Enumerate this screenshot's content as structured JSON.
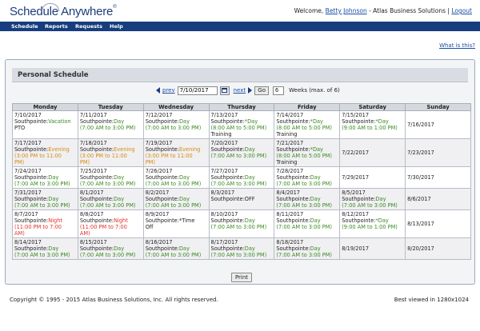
{
  "header": {
    "logo_text": "Schedule Anywhere",
    "logo_mark": "®",
    "welcome_prefix": "Welcome, ",
    "user_name": "Betty Johnson",
    "company": " - Atlas Business Solutions | ",
    "logout": "Logout"
  },
  "nav": {
    "items": [
      "Schedule",
      "Reports",
      "Requests",
      "Help"
    ]
  },
  "help_link": "What is this?",
  "panel": {
    "title": "Personal Schedule",
    "prev_label": "prev",
    "date_value": "7/10/2017",
    "next_label": "next",
    "go_label": "Go",
    "weeks_value": "6",
    "weeks_label": "Weeks (max. of 6)"
  },
  "table": {
    "headers": [
      "Monday",
      "Tuesday",
      "Wednesday",
      "Thursday",
      "Friday",
      "Saturday",
      "Sunday"
    ],
    "rows": [
      [
        {
          "date": "7/10/2017",
          "lines": [
            {
              "text": "Southpointe:",
              "c": "dark"
            },
            {
              "text": "Vacation",
              "c": "day"
            },
            {
              "text": "PTO",
              "c": "dark",
              "br": true
            }
          ]
        },
        {
          "date": "7/11/2017",
          "lines": [
            {
              "text": "Southpointe:",
              "c": "dark"
            },
            {
              "text": "Day",
              "c": "day"
            },
            {
              "text": "(7:00 AM to 3:00 PM)",
              "c": "day",
              "br": true
            }
          ]
        },
        {
          "date": "7/12/2017",
          "lines": [
            {
              "text": "Southpointe:",
              "c": "dark"
            },
            {
              "text": "Day",
              "c": "day"
            },
            {
              "text": "(7:00 AM to 3:00 PM)",
              "c": "day",
              "br": true
            }
          ]
        },
        {
          "date": "7/13/2017",
          "lines": [
            {
              "text": "Southpointe:",
              "c": "dark"
            },
            {
              "text": "*Day",
              "c": "day"
            },
            {
              "text": "(8:00 AM to 5:00 PM)",
              "c": "day",
              "br": true
            },
            {
              "text": "Training",
              "c": "dark",
              "br": true
            }
          ]
        },
        {
          "date": "7/14/2017",
          "lines": [
            {
              "text": "Southpointe:",
              "c": "dark"
            },
            {
              "text": "*Day",
              "c": "day"
            },
            {
              "text": "(8:00 AM to 5:00 PM)",
              "c": "day",
              "br": true
            },
            {
              "text": "Training",
              "c": "dark",
              "br": true
            }
          ]
        },
        {
          "date": "7/15/2017",
          "lines": [
            {
              "text": "Southpointe:",
              "c": "dark"
            },
            {
              "text": "*Day",
              "c": "day"
            },
            {
              "text": "(9:00 AM to 1:00 PM)",
              "c": "day",
              "br": true
            }
          ]
        },
        {
          "date": "7/16/2017",
          "single": true,
          "lines": []
        }
      ],
      [
        {
          "date": "7/17/2017",
          "lines": [
            {
              "text": "Southpointe:",
              "c": "dark"
            },
            {
              "text": "Evening",
              "c": "eve"
            },
            {
              "text": "(3:00 PM to 11:00",
              "c": "eve",
              "br": true
            },
            {
              "text": "PM)",
              "c": "eve",
              "br": true
            }
          ]
        },
        {
          "date": "7/18/2017",
          "lines": [
            {
              "text": "Southpointe:",
              "c": "dark"
            },
            {
              "text": "Evening",
              "c": "eve"
            },
            {
              "text": "(3:00 PM to 11:00",
              "c": "eve",
              "br": true
            },
            {
              "text": "PM)",
              "c": "eve",
              "br": true
            }
          ]
        },
        {
          "date": "7/19/2017",
          "lines": [
            {
              "text": "Southpointe:",
              "c": "dark"
            },
            {
              "text": "Evening",
              "c": "eve"
            },
            {
              "text": "(3:00 PM to 11:00",
              "c": "eve",
              "br": true
            },
            {
              "text": "PM)",
              "c": "eve",
              "br": true
            }
          ]
        },
        {
          "date": "7/20/2017",
          "lines": [
            {
              "text": "Southpointe:",
              "c": "dark"
            },
            {
              "text": "Day",
              "c": "day"
            },
            {
              "text": "(7:00 AM to 3:00 PM)",
              "c": "day",
              "br": true
            }
          ]
        },
        {
          "date": "7/21/2017",
          "lines": [
            {
              "text": "Southpointe:",
              "c": "dark"
            },
            {
              "text": "*Day",
              "c": "day"
            },
            {
              "text": "(8:00 AM to 5:00 PM)",
              "c": "day",
              "br": true
            },
            {
              "text": "Training",
              "c": "dark",
              "br": true
            }
          ]
        },
        {
          "date": "7/22/2017",
          "single": true,
          "lines": []
        },
        {
          "date": "7/23/2017",
          "single": true,
          "lines": []
        }
      ],
      [
        {
          "date": "7/24/2017",
          "lines": [
            {
              "text": "Southpointe:",
              "c": "dark"
            },
            {
              "text": "Day",
              "c": "day"
            },
            {
              "text": "(7:00 AM to 3:00 PM)",
              "c": "day",
              "br": true
            }
          ]
        },
        {
          "date": "7/25/2017",
          "lines": [
            {
              "text": "Southpointe:",
              "c": "dark"
            },
            {
              "text": "Day",
              "c": "day"
            },
            {
              "text": "(7:00 AM to 3:00 PM)",
              "c": "day",
              "br": true
            }
          ]
        },
        {
          "date": "7/26/2017",
          "lines": [
            {
              "text": "Southpointe:",
              "c": "dark"
            },
            {
              "text": "Day",
              "c": "day"
            },
            {
              "text": "(7:00 AM to 3:00 PM)",
              "c": "day",
              "br": true
            }
          ]
        },
        {
          "date": "7/27/2017",
          "lines": [
            {
              "text": "Southpointe:",
              "c": "dark"
            },
            {
              "text": "Day",
              "c": "day"
            },
            {
              "text": "(7:00 AM to 3:00 PM)",
              "c": "day",
              "br": true
            }
          ]
        },
        {
          "date": "7/28/2017",
          "lines": [
            {
              "text": "Southpointe:",
              "c": "dark"
            },
            {
              "text": "Day",
              "c": "day"
            },
            {
              "text": "(7:00 AM to 3:00 PM)",
              "c": "day",
              "br": true
            }
          ]
        },
        {
          "date": "7/29/2017",
          "single": true,
          "lines": []
        },
        {
          "date": "7/30/2017",
          "single": true,
          "lines": []
        }
      ],
      [
        {
          "date": "7/31/2017",
          "lines": [
            {
              "text": "Southpointe:",
              "c": "dark"
            },
            {
              "text": "Day",
              "c": "day"
            },
            {
              "text": "(7:00 AM to 3:00 PM)",
              "c": "day",
              "br": true
            }
          ]
        },
        {
          "date": "8/1/2017",
          "lines": [
            {
              "text": "Southpointe:",
              "c": "dark"
            },
            {
              "text": "Day",
              "c": "day"
            },
            {
              "text": "(7:00 AM to 3:00 PM)",
              "c": "day",
              "br": true
            }
          ]
        },
        {
          "date": "8/2/2017",
          "lines": [
            {
              "text": "Southpointe:",
              "c": "dark"
            },
            {
              "text": "Day",
              "c": "day"
            },
            {
              "text": "(7:00 AM to 3:00 PM)",
              "c": "day",
              "br": true
            }
          ]
        },
        {
          "date": "8/3/2017",
          "lines": [
            {
              "text": "Southpointe:OFF",
              "c": "dark"
            }
          ]
        },
        {
          "date": "8/4/2017",
          "lines": [
            {
              "text": "Southpointe:",
              "c": "dark"
            },
            {
              "text": "Day",
              "c": "day"
            },
            {
              "text": "(7:00 AM to 3:00 PM)",
              "c": "day",
              "br": true
            }
          ]
        },
        {
          "date": "8/5/2017",
          "lines": [
            {
              "text": "Southpointe:",
              "c": "dark"
            },
            {
              "text": "Day",
              "c": "day"
            },
            {
              "text": "(7:00 AM to 3:00 PM)",
              "c": "day",
              "br": true
            }
          ]
        },
        {
          "date": "8/6/2017",
          "single": true,
          "lines": []
        }
      ],
      [
        {
          "date": "8/7/2017",
          "lines": [
            {
              "text": "Southpointe:",
              "c": "dark"
            },
            {
              "text": "Night",
              "c": "night"
            },
            {
              "text": "(11:00 PM to 7:00",
              "c": "night",
              "br": true
            },
            {
              "text": "AM)",
              "c": "night",
              "br": true
            }
          ]
        },
        {
          "date": "8/8/2017",
          "lines": [
            {
              "text": "Southpointe:",
              "c": "dark"
            },
            {
              "text": "Night",
              "c": "night"
            },
            {
              "text": "(11:00 PM to 7:00",
              "c": "night",
              "br": true
            },
            {
              "text": "AM)",
              "c": "night",
              "br": true
            }
          ]
        },
        {
          "date": "8/9/2017",
          "lines": [
            {
              "text": "Southpointe:",
              "c": "dark"
            },
            {
              "text": "*Time",
              "c": "dark"
            },
            {
              "text": "Off",
              "c": "dark",
              "br": true
            }
          ]
        },
        {
          "date": "8/10/2017",
          "lines": [
            {
              "text": "Southpointe:",
              "c": "dark"
            },
            {
              "text": "Day",
              "c": "day"
            },
            {
              "text": "(7:00 AM to 3:00 PM)",
              "c": "day",
              "br": true
            }
          ]
        },
        {
          "date": "8/11/2017",
          "lines": [
            {
              "text": "Southpointe:",
              "c": "dark"
            },
            {
              "text": "Day",
              "c": "day"
            },
            {
              "text": "(7:00 AM to 3:00 PM)",
              "c": "day",
              "br": true
            }
          ]
        },
        {
          "date": "8/12/2017",
          "lines": [
            {
              "text": "Southpointe:",
              "c": "dark"
            },
            {
              "text": "*Day",
              "c": "day"
            },
            {
              "text": "(9:00 AM to 1:00 PM)",
              "c": "day",
              "br": true
            }
          ]
        },
        {
          "date": "8/13/2017",
          "single": true,
          "lines": []
        }
      ],
      [
        {
          "date": "8/14/2017",
          "lines": [
            {
              "text": "Southpointe:",
              "c": "dark"
            },
            {
              "text": "Day",
              "c": "day"
            },
            {
              "text": "(7:00 AM to 3:00 PM)",
              "c": "day",
              "br": true
            }
          ]
        },
        {
          "date": "8/15/2017",
          "lines": [
            {
              "text": "Southpointe:",
              "c": "dark"
            },
            {
              "text": "Day",
              "c": "day"
            },
            {
              "text": "(7:00 AM to 3:00 PM)",
              "c": "day",
              "br": true
            }
          ]
        },
        {
          "date": "8/16/2017",
          "lines": [
            {
              "text": "Southpointe:",
              "c": "dark"
            },
            {
              "text": "Day",
              "c": "day"
            },
            {
              "text": "(7:00 AM to 3:00 PM)",
              "c": "day",
              "br": true
            }
          ]
        },
        {
          "date": "8/17/2017",
          "lines": [
            {
              "text": "Southpointe:",
              "c": "dark"
            },
            {
              "text": "Day",
              "c": "day"
            },
            {
              "text": "(7:00 AM to 3:00 PM)",
              "c": "day",
              "br": true
            }
          ]
        },
        {
          "date": "8/18/2017",
          "lines": [
            {
              "text": "Southpointe:",
              "c": "dark"
            },
            {
              "text": "Day",
              "c": "day"
            },
            {
              "text": "(7:00 AM to 3:00 PM)",
              "c": "day",
              "br": true
            }
          ]
        },
        {
          "date": "8/19/2017",
          "single": true,
          "lines": []
        },
        {
          "date": "8/20/2017",
          "single": true,
          "lines": []
        }
      ]
    ]
  },
  "print_label": "Print",
  "footer": {
    "copyright": "Copyright © 1995 - 2015 Atlas Business Solutions, Inc. All rights reserved.",
    "best_viewed": "Best viewed in 1280x1024"
  },
  "colors": {
    "nav_bg": "#173d7e",
    "day": "#3a8a22",
    "evening": "#d68a12",
    "night": "#e0322a",
    "link": "#1a4ea8"
  }
}
